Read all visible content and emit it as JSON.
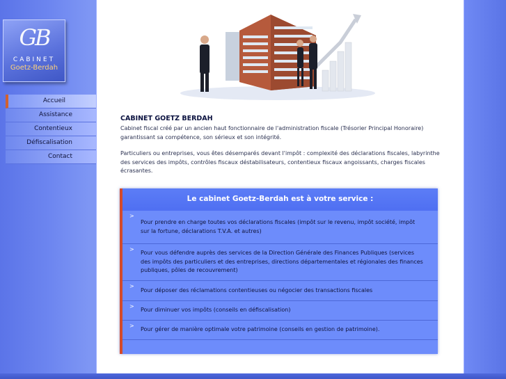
{
  "logo": {
    "mark": "GB",
    "line1": "CABINET",
    "line2": "Goetz-Berdah"
  },
  "menu": {
    "items": [
      {
        "label": "Accueil",
        "active": true
      },
      {
        "label": "Assistance",
        "active": false
      },
      {
        "label": "Contentieux",
        "active": false
      },
      {
        "label": "Défiscalisation",
        "active": false
      },
      {
        "label": "Contact",
        "active": false
      }
    ]
  },
  "main": {
    "title": "CABINET GOETZ BERDAH",
    "intro1": "Cabinet fiscal créé par un ancien haut fonctionnaire de l'administration fiscale (Trésorier Principal Honoraire) garantissant sa compétence, son sérieux et son intégrité.",
    "intro2": "Particuliers ou entreprises, vous êtes désemparés devant l'impôt : complexité des déclarations fiscales, labyrinthe des services des impôts, contrôles fiscaux déstabilisateurs, contentieux fiscaux angoissants, charges fiscales écrasantes."
  },
  "service": {
    "heading": "Le cabinet Goetz-Berdah est à votre service :",
    "bullet": ">",
    "items": [
      "Pour prendre en charge toutes vos déclarations fiscales (impôt sur le revenu, impôt société, impôt sur la fortune, déclarations T.V.A. et autres)",
      "Pour vous défendre auprès des services de la Direction Générale des Finances Publiques (services des impôts des particuliers et des entreprises, directions départementales et régionales des finances publiques, pôles de recouvrement)",
      "Pour déposer des réclamations contentieuses ou négocier des transactions fiscales",
      "Pour diminuer vos impôts (conseils en défiscalisation)",
      "Pour gérer de manière optimale votre patrimoine (conseils en gestion de patrimoine)."
    ]
  },
  "colors": {
    "accent": "#d44a2a",
    "panel": "#6d8cfb",
    "background": "#6f88ee"
  }
}
